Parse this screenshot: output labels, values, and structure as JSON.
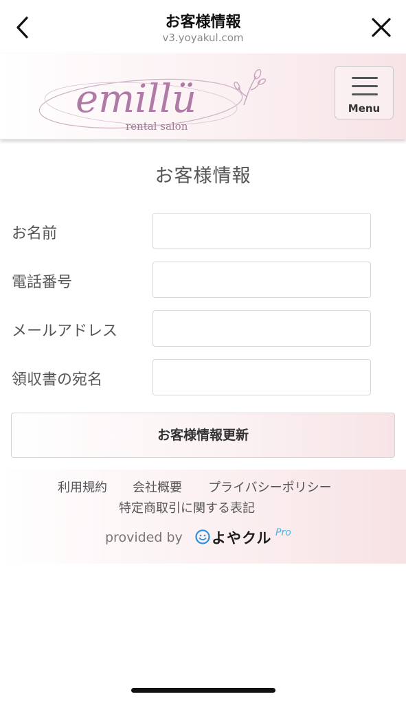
{
  "topbar": {
    "title": "お客様情報",
    "url": "v3.yoyakul.com"
  },
  "header": {
    "logo_text": "emillü",
    "logo_subtext": "rental salon",
    "menu_label": "Menu"
  },
  "page": {
    "title": "お客様情報"
  },
  "form": {
    "fields": [
      {
        "label": "お名前",
        "value": ""
      },
      {
        "label": "電話番号",
        "value": ""
      },
      {
        "label": "メールアドレス",
        "value": ""
      },
      {
        "label": "領収書の宛名",
        "value": ""
      }
    ],
    "submit_label": "お客様情報更新"
  },
  "footer": {
    "links": [
      "利用規約",
      "会社概要",
      "プライバシーポリシー",
      "特定商取引に関する表記"
    ],
    "provided_by": "provided by",
    "brand_name": "よやクル",
    "brand_suffix": "Pro"
  },
  "colors": {
    "logo": "#b07aa6",
    "header_gradient_end": "#f7e3e6",
    "brand_accent": "#4bb3e6"
  }
}
